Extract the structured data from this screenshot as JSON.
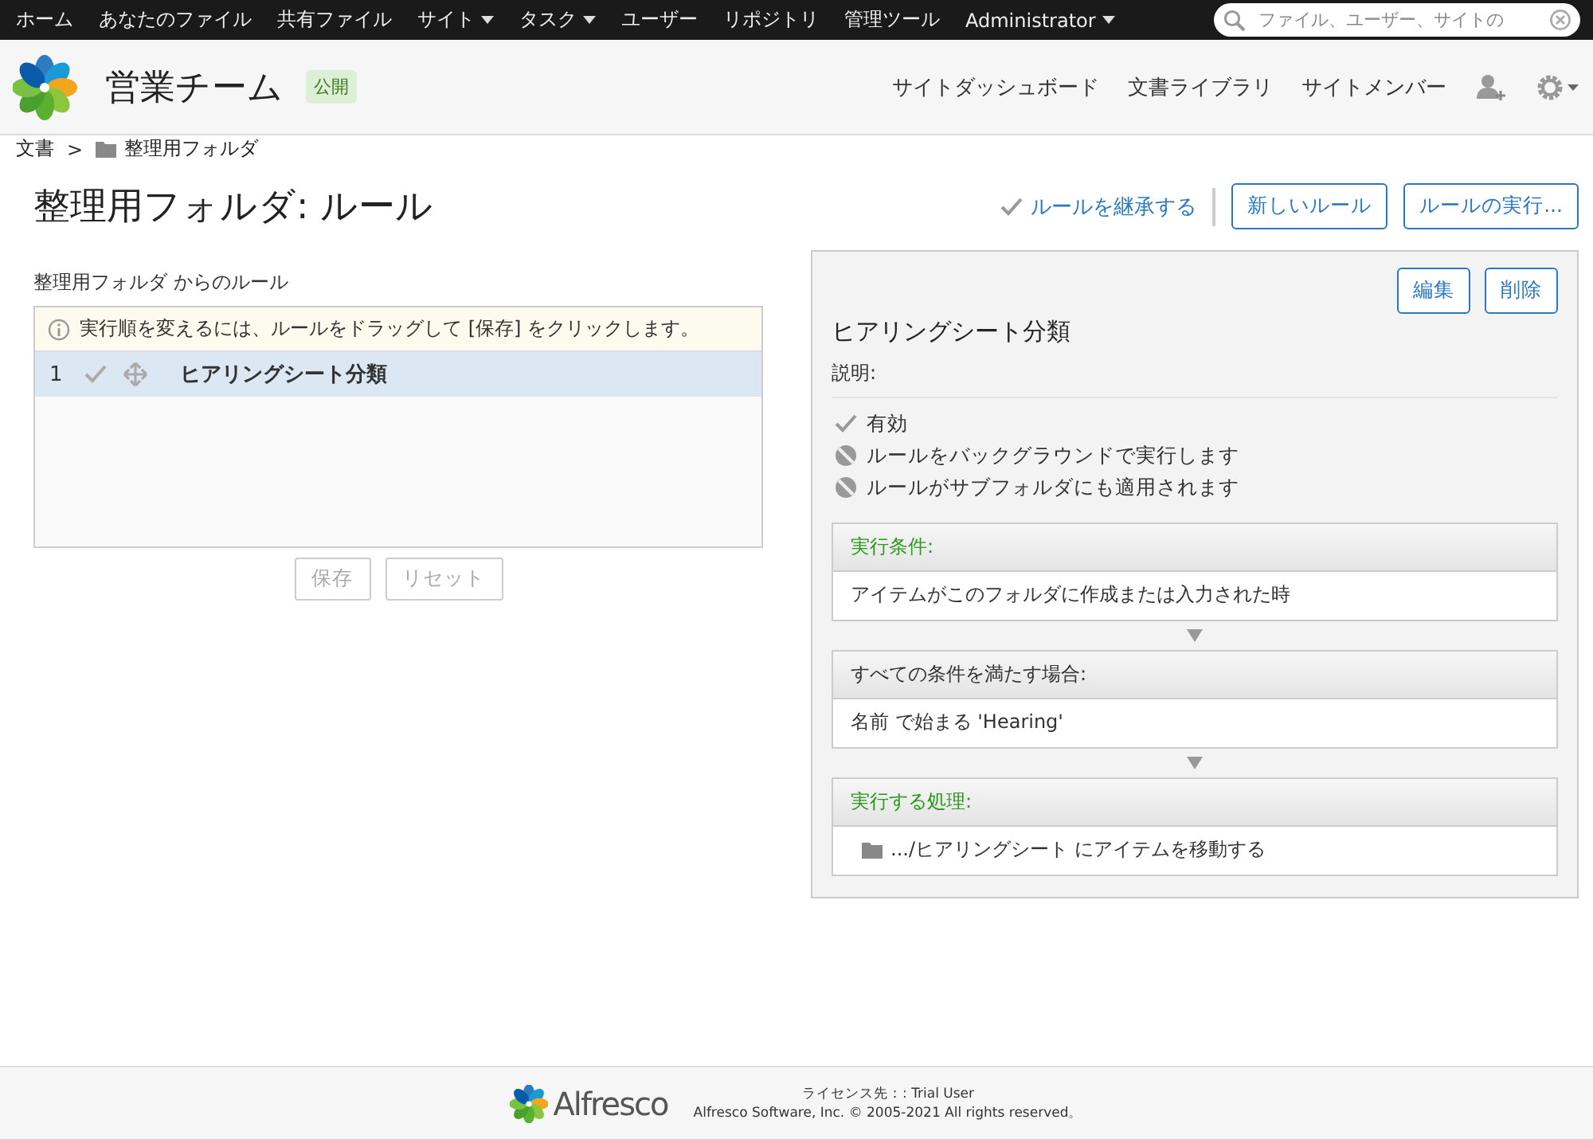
{
  "top_nav": {
    "items": [
      {
        "label": "ホーム",
        "dropdown": false
      },
      {
        "label": "あなたのファイル",
        "dropdown": false
      },
      {
        "label": "共有ファイル",
        "dropdown": false
      },
      {
        "label": "サイト",
        "dropdown": true
      },
      {
        "label": "タスク",
        "dropdown": true
      },
      {
        "label": "ユーザー",
        "dropdown": false
      },
      {
        "label": "リポジトリ",
        "dropdown": false
      },
      {
        "label": "管理ツール",
        "dropdown": false
      },
      {
        "label": "Administrator",
        "dropdown": true
      }
    ],
    "search": {
      "placeholder": "ファイル、ユーザー、サイトの"
    }
  },
  "site_header": {
    "title": "営業チーム",
    "badge": "公開",
    "links": [
      "サイトダッシュボード",
      "文書ライブラリ",
      "サイトメンバー"
    ]
  },
  "breadcrumb": {
    "separator": ">",
    "items": [
      {
        "label": "文書",
        "kind": "root"
      },
      {
        "label": "整理用フォルダ",
        "kind": "folder"
      }
    ]
  },
  "page_title": "整理用フォルダ: ルール",
  "toolbar": {
    "inherit": {
      "label": "ルールを継承する",
      "checked": true
    },
    "buttons": [
      "新しいルール",
      "ルールの実行..."
    ]
  },
  "rules_list": {
    "heading": "整理用フォルダ からのルール",
    "info": "実行順を変えるには、ルールをドラッグして [保存] をクリックします。",
    "rules": [
      {
        "index": "1",
        "name": "ヒアリングシート分類",
        "enabled": true,
        "selected": true
      }
    ],
    "buttons": [
      {
        "label": "保存",
        "disabled": true
      },
      {
        "label": "リセット",
        "disabled": true
      }
    ]
  },
  "detail": {
    "buttons": [
      "編集",
      "削除"
    ],
    "name": "ヒアリングシート分類",
    "description_label": "説明:",
    "options": [
      {
        "label": "有効",
        "on": true
      },
      {
        "label": "ルールをバックグラウンドで実行します",
        "on": false
      },
      {
        "label": "ルールがサブフォルダにも適用されます",
        "on": false
      }
    ],
    "sections": [
      {
        "kind": "trigger",
        "heading": "実行条件:",
        "body": "アイテムがこのフォルダに作成または入力された時"
      },
      {
        "kind": "condition",
        "heading": "すべての条件を満たす場合:",
        "body": "名前 で始まる 'Hearing'"
      },
      {
        "kind": "action",
        "heading": "実行する処理:",
        "body": ".../ヒアリングシート にアイテムを移動する"
      }
    ]
  },
  "footer": {
    "logo_text": "Alfresco",
    "license": "ライセンス先：: Trial User",
    "copyright": "Alfresco Software, Inc. © 2005-2021 All rights reserved。"
  }
}
